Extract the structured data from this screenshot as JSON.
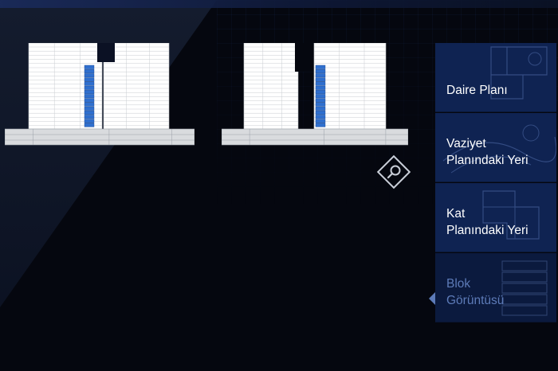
{
  "colors": {
    "background": "#05070f",
    "panel": "#0f2352",
    "active_text": "#5d7bb8",
    "highlight_floor": "#2f6fce"
  },
  "menu": {
    "items": [
      {
        "line1": "Daire Planı",
        "line2": "",
        "active": false
      },
      {
        "line1": "Vaziyet",
        "line2": "Planındaki Yeri",
        "active": false
      },
      {
        "line1": "Kat",
        "line2": "Planındaki Yeri",
        "active": false
      },
      {
        "line1": "Blok",
        "line2": "Görüntüsü",
        "active": true
      }
    ]
  },
  "zoom_button": {
    "icon": "magnifier-icon"
  }
}
